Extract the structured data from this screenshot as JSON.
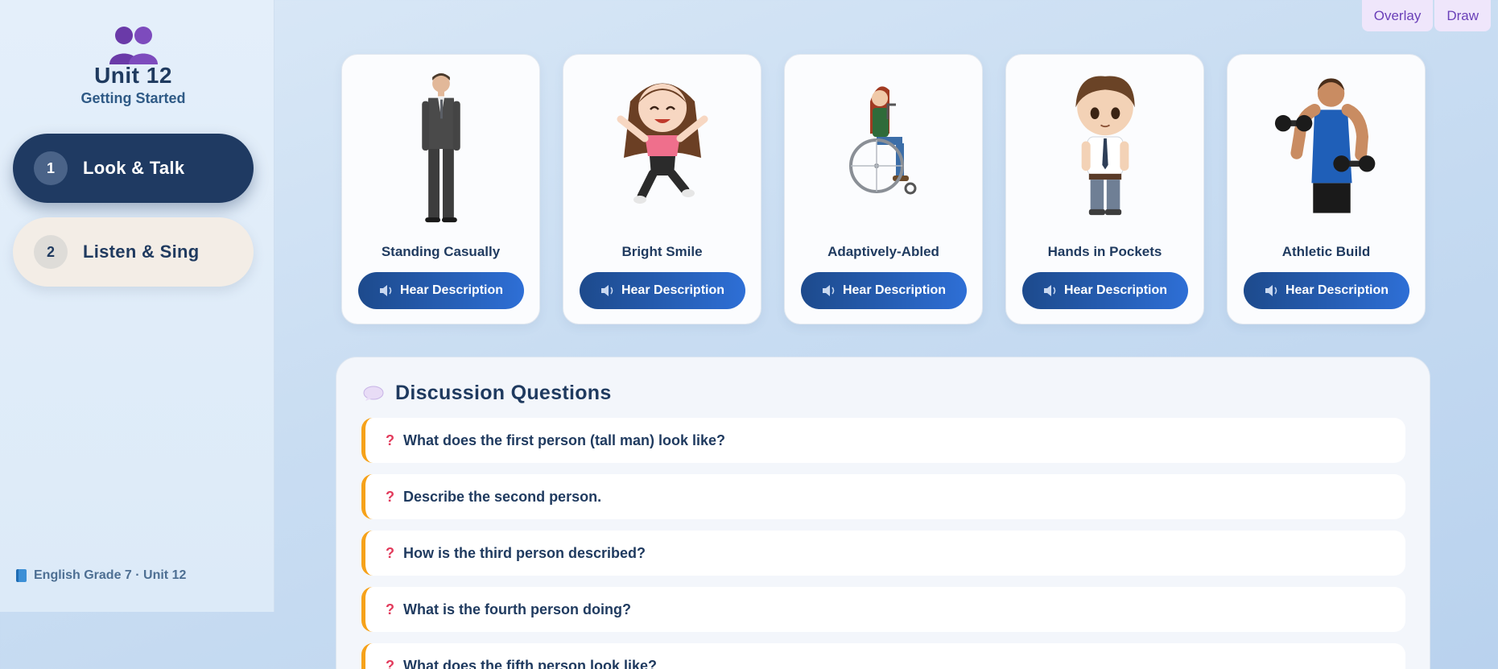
{
  "sidebar": {
    "unit_title": "Unit 12",
    "unit_subtitle": "Getting Started",
    "brand_icon": "two-people-icon",
    "nav": [
      {
        "num": "1",
        "label": "Look & Talk",
        "active": true
      },
      {
        "num": "2",
        "label": "Listen & Sing",
        "active": false
      }
    ],
    "footer": "English Grade 7 · Unit 12"
  },
  "tools": {
    "overlay": "Overlay",
    "draw": "Draw"
  },
  "cards": [
    {
      "name": "Standing Casually",
      "button": "Hear Description"
    },
    {
      "name": "Bright Smile",
      "button": "Hear Description"
    },
    {
      "name": "Adaptively-Abled",
      "button": "Hear Description"
    },
    {
      "name": "Hands in Pockets",
      "button": "Hear Description"
    },
    {
      "name": "Athletic Build",
      "button": "Hear Description"
    }
  ],
  "discussion": {
    "title": "Discussion Questions",
    "questions": [
      "What does the first person (tall man) look like?",
      "Describe the second person.",
      "How is the third person described?",
      "What is the fourth person doing?",
      "What does the fifth person look like?"
    ]
  },
  "colors": {
    "nav_active": "#1f3a62",
    "nav_idle": "#f3ede6",
    "button_gradient_start": "#1d4a8c",
    "button_gradient_end": "#2e6fd6",
    "question_accent": "#f6a21a",
    "question_mark": "#e23b5c",
    "tool_bg": "#efe6fb"
  }
}
